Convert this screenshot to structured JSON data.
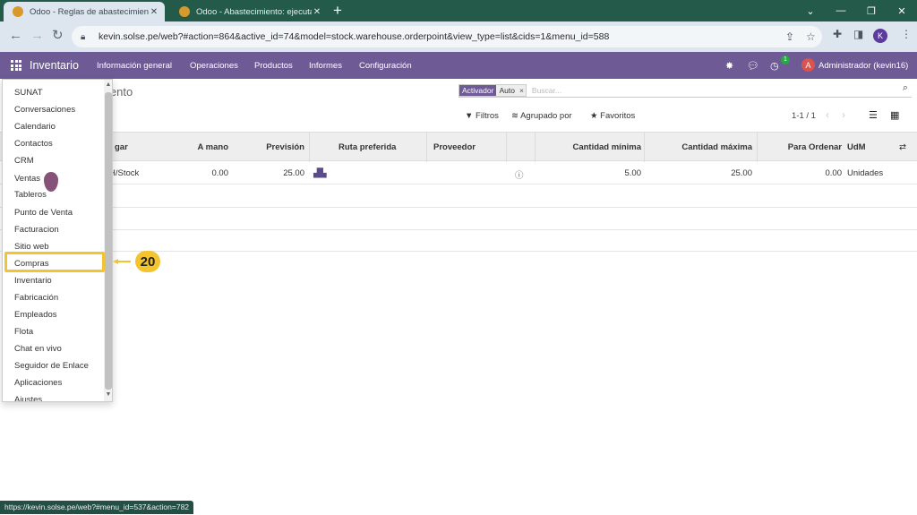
{
  "browser": {
    "tabs": [
      {
        "title": "Odoo - Reglas de abastecimient",
        "close": "✕"
      },
      {
        "title": "Odoo - Abastecimiento: ejecutar",
        "close": "✕"
      }
    ],
    "new_tab": "+",
    "window_controls": [
      "⌄",
      "—",
      "❐",
      "✕"
    ],
    "url": "kevin.solse.pe/web?#action=864&active_id=74&model=stock.warehouse.orderpoint&view_type=list&cids=1&menu_id=588",
    "profile_initial": "K",
    "status_url": "https://kevin.solse.pe/web?#menu_id=537&action=782"
  },
  "navbar": {
    "app_name": "Inventario",
    "menus": [
      "Información general",
      "Operaciones",
      "Productos",
      "Informes",
      "Configuración"
    ],
    "activity_badge": "1",
    "user_initial": "A",
    "user_name": "Administrador (kevin16)"
  },
  "control_panel": {
    "breadcrumb": "iento",
    "facet_label": "Activador",
    "facet_value": "Auto",
    "facet_remove": "×",
    "search_placeholder": "Buscar...",
    "filters_label": "Filtros",
    "group_by_label": "Agrupado por",
    "favorites_label": "Favoritos",
    "pager": "1-1 / 1"
  },
  "table": {
    "headers": [
      "gar",
      "A mano",
      "Previsión",
      "Ruta preferida",
      "Proveedor",
      "Cantidad mínima",
      "Cantidad máxima",
      "Para Ordenar",
      "UdM"
    ],
    "rows": [
      {
        "location": "H/Stock",
        "on_hand": "0.00",
        "forecast": "25.00",
        "route": "",
        "vendor": "",
        "min_qty": "5.00",
        "max_qty": "25.00",
        "to_order": "0.00",
        "uom": "Unidades"
      }
    ]
  },
  "app_menu": {
    "items": [
      "SUNAT",
      "Conversaciones",
      "Calendario",
      "Contactos",
      "CRM",
      "Ventas",
      "Tableros",
      "Punto de Venta",
      "Facturacion",
      "Sitio web",
      "Compras",
      "Inventario",
      "Fabricación",
      "Empleados",
      "Flota",
      "Chat en vivo",
      "Seguidor de Enlace",
      "Aplicaciones",
      "Ajustes"
    ],
    "highlighted": "Compras"
  },
  "annotation": {
    "step_number": "20"
  },
  "colors": {
    "navbar": "#6e5b95",
    "highlight": "#f4c430",
    "tabstrip": "#235a4a"
  }
}
